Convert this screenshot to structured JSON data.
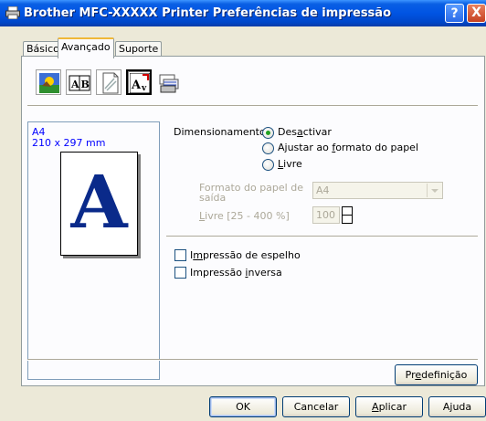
{
  "window": {
    "title": "Brother MFC-XXXXX Printer Preferências de impressão",
    "help_symbol": "?",
    "close_symbol": "X"
  },
  "tabs": [
    {
      "label": "Básico",
      "active": false
    },
    {
      "label": "Avançado",
      "active": true
    },
    {
      "label": "Suporte",
      "active": false
    }
  ],
  "toolbar": [
    {
      "icon": "color-settings-icon",
      "selected": false
    },
    {
      "icon": "ab-layout-icon",
      "selected": false
    },
    {
      "icon": "watermark-icon",
      "selected": false
    },
    {
      "icon": "scaling-icon",
      "selected": true
    },
    {
      "icon": "device-options-icon",
      "selected": false
    }
  ],
  "preview": {
    "paper": "A4",
    "dimensions": "210 x 297 mm",
    "letter": "A"
  },
  "scaling": {
    "label": "Dimensionamento",
    "options": [
      {
        "pre": "Des",
        "key": "a",
        "post": "ctivar",
        "checked": true
      },
      {
        "pre": "Ajustar ao ",
        "key": "f",
        "post": "ormato do papel",
        "checked": false
      },
      {
        "pre": "",
        "key": "L",
        "post": "ivre",
        "checked": false
      }
    ],
    "output_paper_label_line1": "Formato do papel de",
    "output_paper_label_line2": "saída",
    "output_paper_value": "A4",
    "free_label_key": "L",
    "free_label_rest": "ivre [25 - 400 %]",
    "free_value": "100"
  },
  "mirror": {
    "pre": "I",
    "key": "m",
    "post": "pressão de espelho",
    "checked": false
  },
  "reverse": {
    "pre": "Impressão ",
    "key": "i",
    "post": "nversa",
    "checked": false
  },
  "buttons": {
    "default_pre": "Pr",
    "default_key": "e",
    "default_post": "definição",
    "ok": "OK",
    "cancel": "Cancelar",
    "apply_key": "A",
    "apply_rest": "plicar",
    "help": "Ajuda"
  }
}
